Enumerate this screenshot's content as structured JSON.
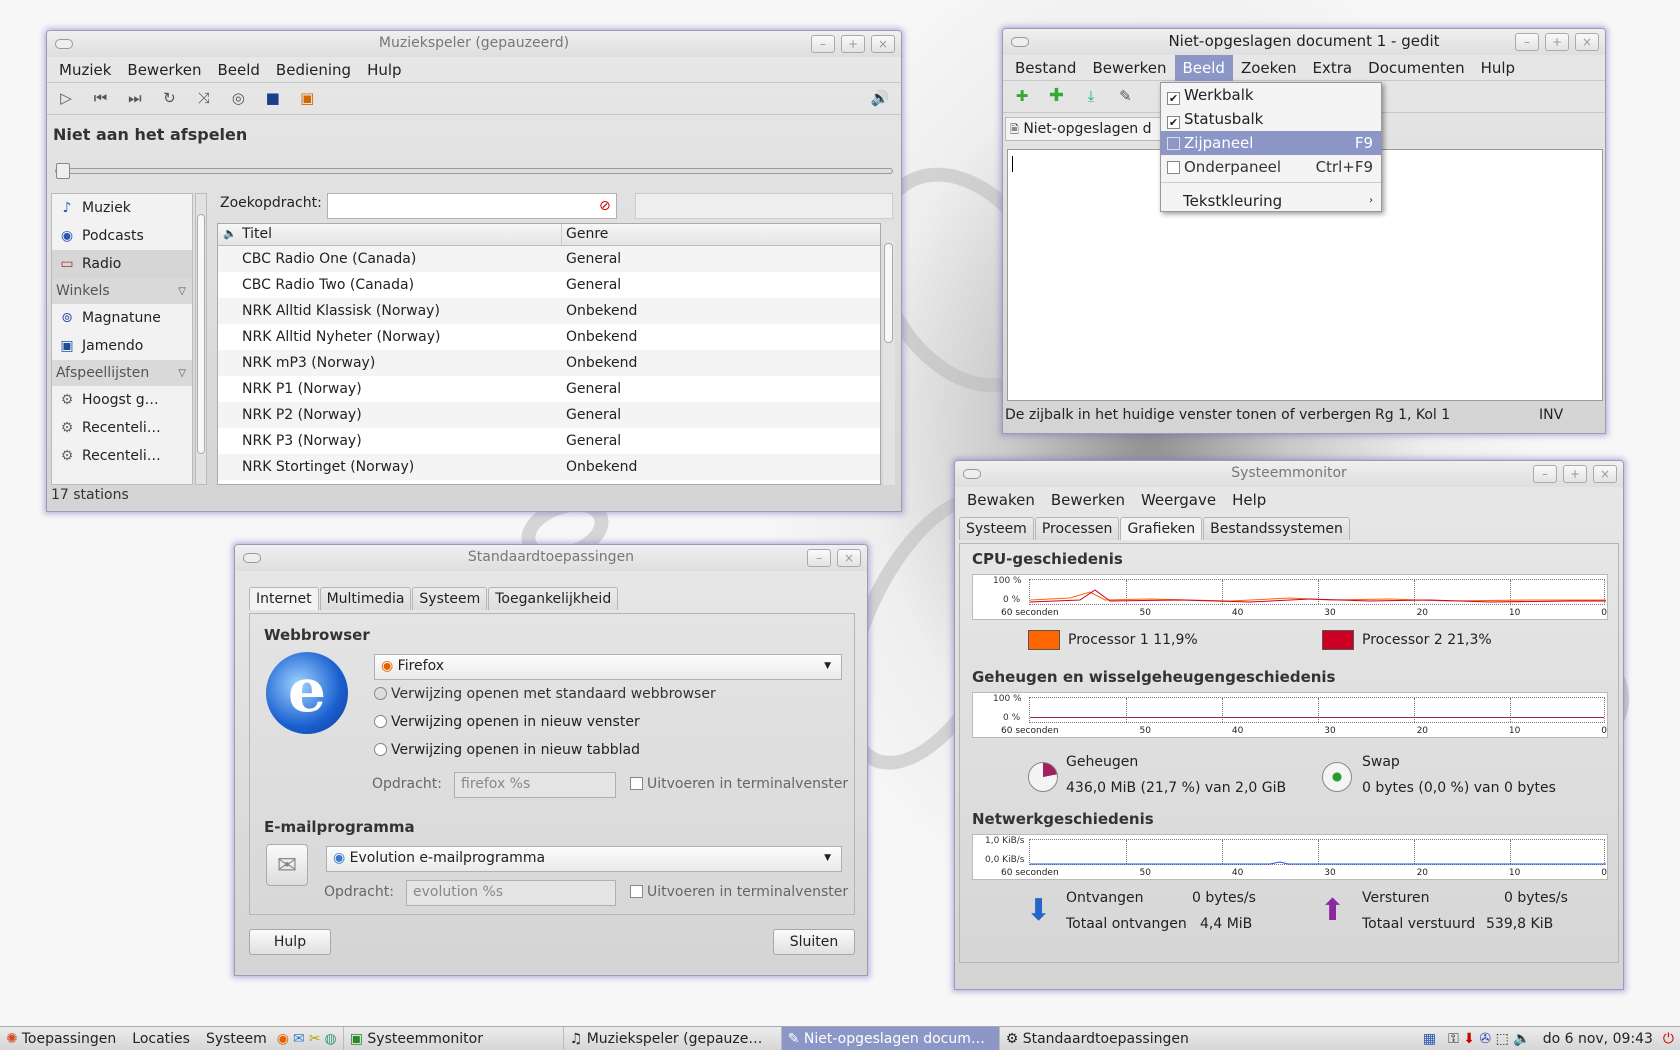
{
  "music": {
    "title": "Muziekspeler (gepauzeerd)",
    "menu": [
      "Muziek",
      "Bewerken",
      "Beeld",
      "Bediening",
      "Hulp"
    ],
    "status_text": "Niet aan het afspelen",
    "sidebar": {
      "library": [
        "Muziek",
        "Podcasts",
        "Radio"
      ],
      "stores_header": "Winkels",
      "stores": [
        "Magnatune",
        "Jamendo"
      ],
      "playlists_header": "Afspeellijsten",
      "playlists": [
        "Hoogst g…",
        "Recenteli…",
        "Recenteli…"
      ]
    },
    "search_label": "Zoekopdracht:",
    "columns": [
      "Titel",
      "Genre"
    ],
    "rows": [
      [
        "CBC Radio One (Canada)",
        "General"
      ],
      [
        "CBC Radio Two (Canada)",
        "General"
      ],
      [
        "NRK Alltid Klassisk (Norway)",
        "Onbekend"
      ],
      [
        "NRK Alltid Nyheter (Norway)",
        "Onbekend"
      ],
      [
        "NRK mP3 (Norway)",
        "Onbekend"
      ],
      [
        "NRK P1 (Norway)",
        "General"
      ],
      [
        "NRK P2 (Norway)",
        "General"
      ],
      [
        "NRK P3 (Norway)",
        "General"
      ],
      [
        "NRK Stortinget (Norway)",
        "Onbekend"
      ]
    ],
    "footer": "17 stations"
  },
  "gedit": {
    "title": "Niet-opgeslagen document 1 - gedit",
    "menu": [
      "Bestand",
      "Bewerken",
      "Beeld",
      "Zoeken",
      "Extra",
      "Documenten",
      "Hulp"
    ],
    "tab": "Niet-opgeslagen d",
    "dropdown": [
      {
        "label": "Werkbalk",
        "checked": true,
        "shortcut": ""
      },
      {
        "label": "Statusbalk",
        "checked": true,
        "shortcut": ""
      },
      {
        "label": "Zijpaneel",
        "checked": false,
        "shortcut": "F9"
      },
      {
        "label": "Onderpaneel",
        "checked": false,
        "shortcut": "Ctrl+F9"
      }
    ],
    "dropdown_sub": "Tekstkleuring",
    "status": "De zijbalk in het huidige venster tonen of verbergen",
    "position": "Rg 1, Kol 1",
    "mode": "INV"
  },
  "apps": {
    "title": "Standaardtoepassingen",
    "tabs": [
      "Internet",
      "Multimedia",
      "Systeem",
      "Toegankelijkheid"
    ],
    "web_header": "Webbrowser",
    "browser": "Firefox",
    "options": [
      "Verwijzing openen met standaard webbrowser",
      "Verwijzing openen in nieuw venster",
      "Verwijzing openen in nieuw tabblad"
    ],
    "command_label": "Opdracht:",
    "web_command": "firefox %s",
    "terminal_label": "Uitvoeren in terminalvenster",
    "mail_header": "E-mailprogramma",
    "mail_app": "Evolution e-mailprogramma",
    "mail_command": "evolution %s",
    "help": "Hulp",
    "close": "Sluiten"
  },
  "sysmon": {
    "title": "Systeemmonitor",
    "menu": [
      "Bewaken",
      "Bewerken",
      "Weergave",
      "Help"
    ],
    "tabs": [
      "Systeem",
      "Processen",
      "Grafieken",
      "Bestandssystemen"
    ],
    "cpu_header": "CPU-geschiedenis",
    "axis_pct": [
      "100 %",
      "0 %"
    ],
    "axis_net": [
      "1,0 KiB/s",
      "0,0 KiB/s"
    ],
    "axis_x": [
      "60 seconden",
      "50",
      "40",
      "30",
      "20",
      "10",
      "0"
    ],
    "cpu1": "Processor 1 11,9%",
    "cpu2": "Processor 2 21,3%",
    "mem_header": "Geheugen en wisselgeheugengeschiedenis",
    "mem_label": "Geheugen",
    "mem_value": "436,0 MiB (21,7 %) van 2,0 GiB",
    "swap_label": "Swap",
    "swap_value": "0 bytes (0,0 %) van 0 bytes",
    "net_header": "Netwerkgeschiedenis",
    "recv_label": "Ontvangen",
    "recv_rate": "0 bytes/s",
    "recv_total_label": "Totaal ontvangen",
    "recv_total": "4,4 MiB",
    "send_label": "Versturen",
    "send_rate": "0 bytes/s",
    "send_total_label": "Totaal verstuurd",
    "send_total": "539,8 KiB",
    "colors": {
      "cpu1": "#ff6600",
      "cpu2": "#cc0022"
    }
  },
  "taskbar": {
    "menus": [
      "Toepassingen",
      "Locaties",
      "Systeem"
    ],
    "tasks": [
      "Systeemmonitor",
      "Muziekspeler (gepauze…",
      "Niet-opgeslagen docum…",
      "Standaardtoepassingen"
    ],
    "clock": "do  6 nov, 09:43"
  }
}
